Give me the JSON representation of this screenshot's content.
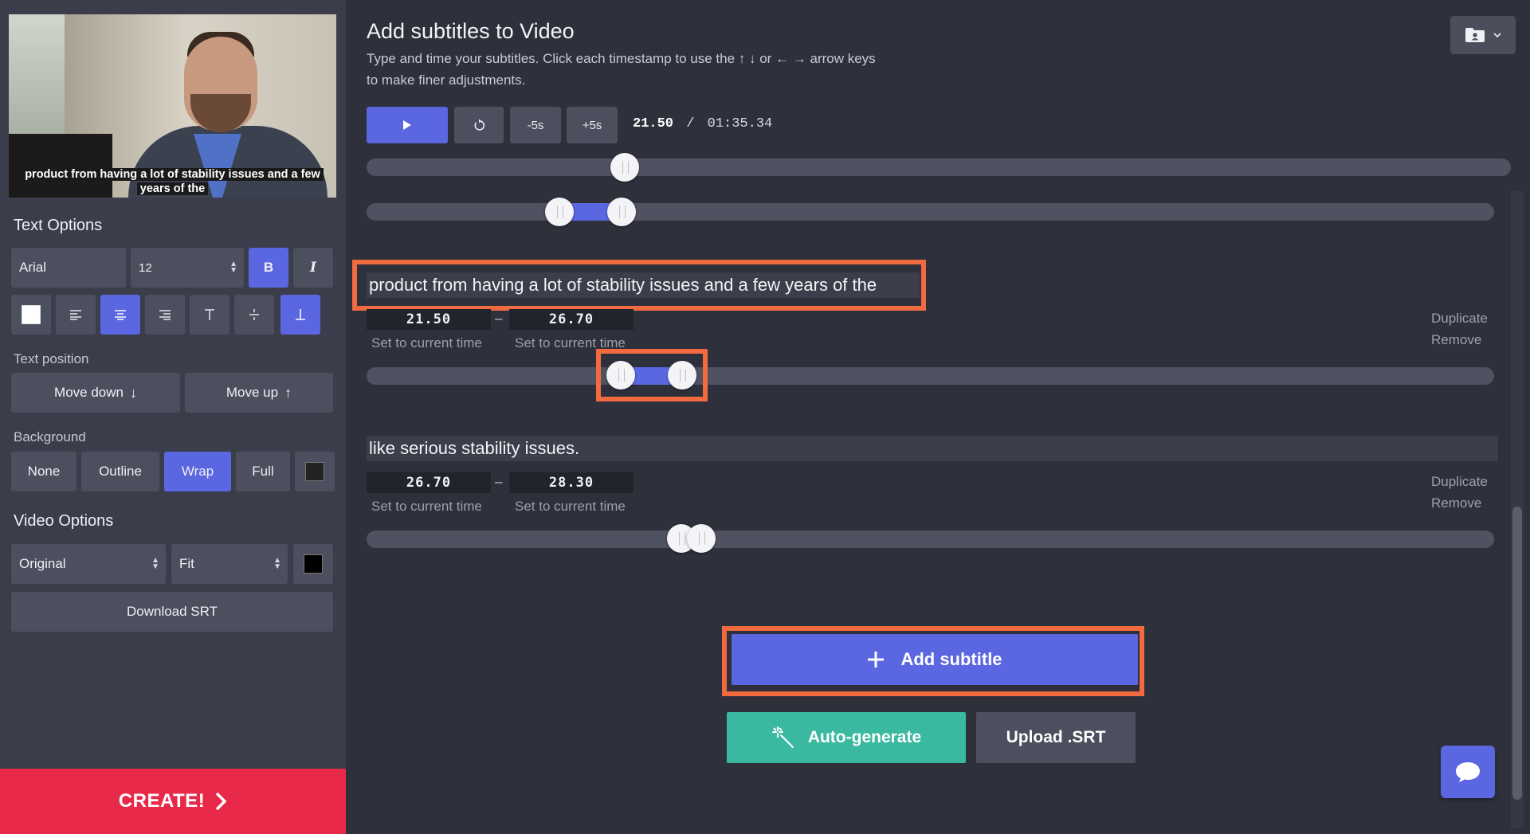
{
  "video": {
    "caption": "product from having a lot of stability issues and a few years of the"
  },
  "text_options": {
    "title": "Text Options",
    "font": "Arial",
    "size": "12",
    "bold_label": "B",
    "italic_label": "I",
    "text_color": "#ffffff"
  },
  "text_position": {
    "title": "Text position",
    "move_down": "Move down",
    "move_up": "Move up"
  },
  "background": {
    "title": "Background",
    "options": [
      "None",
      "Outline",
      "Wrap",
      "Full"
    ],
    "selected": "Wrap",
    "color": "#222222"
  },
  "video_options": {
    "title": "Video Options",
    "size": "Original",
    "fit": "Fit",
    "color": "#000000",
    "download": "Download SRT"
  },
  "create_label": "CREATE!",
  "main": {
    "title": "Add subtitles to Video",
    "description": "Type and time your subtitles. Click each timestamp to use the ↑ ↓ or ← → arrow keys to make finer adjustments."
  },
  "player": {
    "minus5": "-5s",
    "plus5": "+5s",
    "current": "21.50",
    "separator": "/",
    "total": "01:35.34"
  },
  "subtitles": [
    {
      "text": "product from having a lot of stability issues and a few years of the",
      "start": "21.50",
      "end": "26.70",
      "set_current": "Set to current time",
      "duplicate": "Duplicate",
      "remove": "Remove"
    },
    {
      "text": "like serious stability issues.",
      "start": "26.70",
      "end": "28.30",
      "set_current": "Set to current time",
      "duplicate": "Duplicate",
      "remove": "Remove"
    }
  ],
  "actions": {
    "add_subtitle": "Add subtitle",
    "auto_generate": "Auto-generate",
    "upload_srt": "Upload .SRT"
  },
  "colors": {
    "accent": "#5b67e0",
    "create": "#e8294a",
    "auto": "#3bb9a0",
    "highlight": "#f26a3f"
  }
}
